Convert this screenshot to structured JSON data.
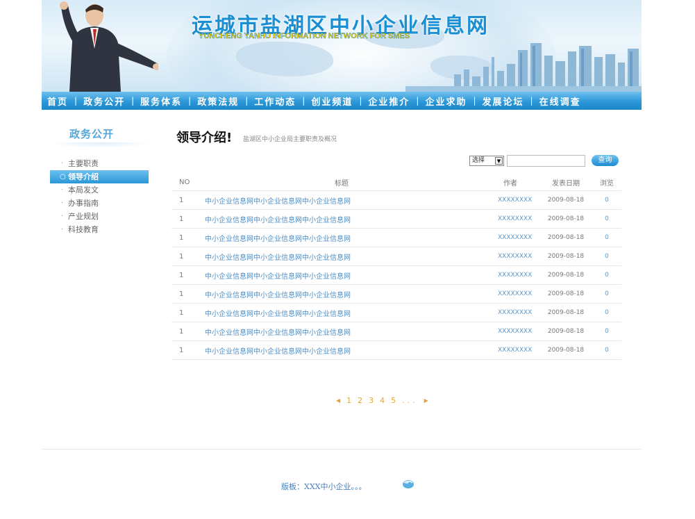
{
  "header": {
    "site_title": "运城市盐湖区中小企业信息网",
    "site_subtitle": "YUNCHENG YANHU INFORMATION NETWORK FOR SMES"
  },
  "nav": {
    "items": [
      "首页",
      "政务公开",
      "服务体系",
      "政策法规",
      "工作动态",
      "创业频道",
      "企业推介",
      "企业求助",
      "发展论坛",
      "在线调查"
    ],
    "separator": "|"
  },
  "sidebar": {
    "title": "政务公开",
    "items": [
      {
        "label": "主要职责",
        "active": false
      },
      {
        "label": "领导介绍",
        "active": true
      },
      {
        "label": "本局发文",
        "active": false
      },
      {
        "label": "办事指南",
        "active": false
      },
      {
        "label": "产业规划",
        "active": false
      },
      {
        "label": "科技教育",
        "active": false
      }
    ]
  },
  "main": {
    "title": "领导介绍!",
    "description": "盐湖区中小企业局主要职责及概况"
  },
  "search": {
    "select_value": "选择",
    "input_value": "",
    "button_label": "查询"
  },
  "table": {
    "columns": [
      "NO",
      "标题",
      "作者",
      "发表日期",
      "浏览"
    ],
    "rows": [
      {
        "no": "1",
        "title": "中小企业信息网中小企业信息网中小企业信息网",
        "author": "XXXXXXXX",
        "date": "2009-08-18",
        "views": "0"
      },
      {
        "no": "1",
        "title": "中小企业信息网中小企业信息网中小企业信息网",
        "author": "XXXXXXXX",
        "date": "2009-08-18",
        "views": "0"
      },
      {
        "no": "1",
        "title": "中小企业信息网中小企业信息网中小企业信息网",
        "author": "XXXXXXXX",
        "date": "2009-08-18",
        "views": "0"
      },
      {
        "no": "1",
        "title": "中小企业信息网中小企业信息网中小企业信息网",
        "author": "XXXXXXXX",
        "date": "2009-08-18",
        "views": "0"
      },
      {
        "no": "1",
        "title": "中小企业信息网中小企业信息网中小企业信息网",
        "author": "XXXXXXXX",
        "date": "2009-08-18",
        "views": "0"
      },
      {
        "no": "1",
        "title": "中小企业信息网中小企业信息网中小企业信息网",
        "author": "XXXXXXXX",
        "date": "2009-08-18",
        "views": "0"
      },
      {
        "no": "1",
        "title": "中小企业信息网中小企业信息网中小企业信息网",
        "author": "XXXXXXXX",
        "date": "2009-08-18",
        "views": "0"
      },
      {
        "no": "1",
        "title": "中小企业信息网中小企业信息网中小企业信息网",
        "author": "XXXXXXXX",
        "date": "2009-08-18",
        "views": "0"
      },
      {
        "no": "1",
        "title": "中小企业信息网中小企业信息网中小企业信息网",
        "author": "XXXXXXXX",
        "date": "2009-08-18",
        "views": "0"
      }
    ]
  },
  "pagination": {
    "prev": "◀",
    "pages": [
      "1",
      "2",
      "3",
      "4",
      "5"
    ],
    "ellipsis": "...",
    "next": "▶"
  },
  "footer": {
    "copyright": "版板：XXX中小企业。。。"
  },
  "colors": {
    "nav_blue": "#2c98d8",
    "title_blue": "#1b8fd3",
    "link_blue": "#4a8ec6",
    "pager_orange": "#e5a630"
  }
}
